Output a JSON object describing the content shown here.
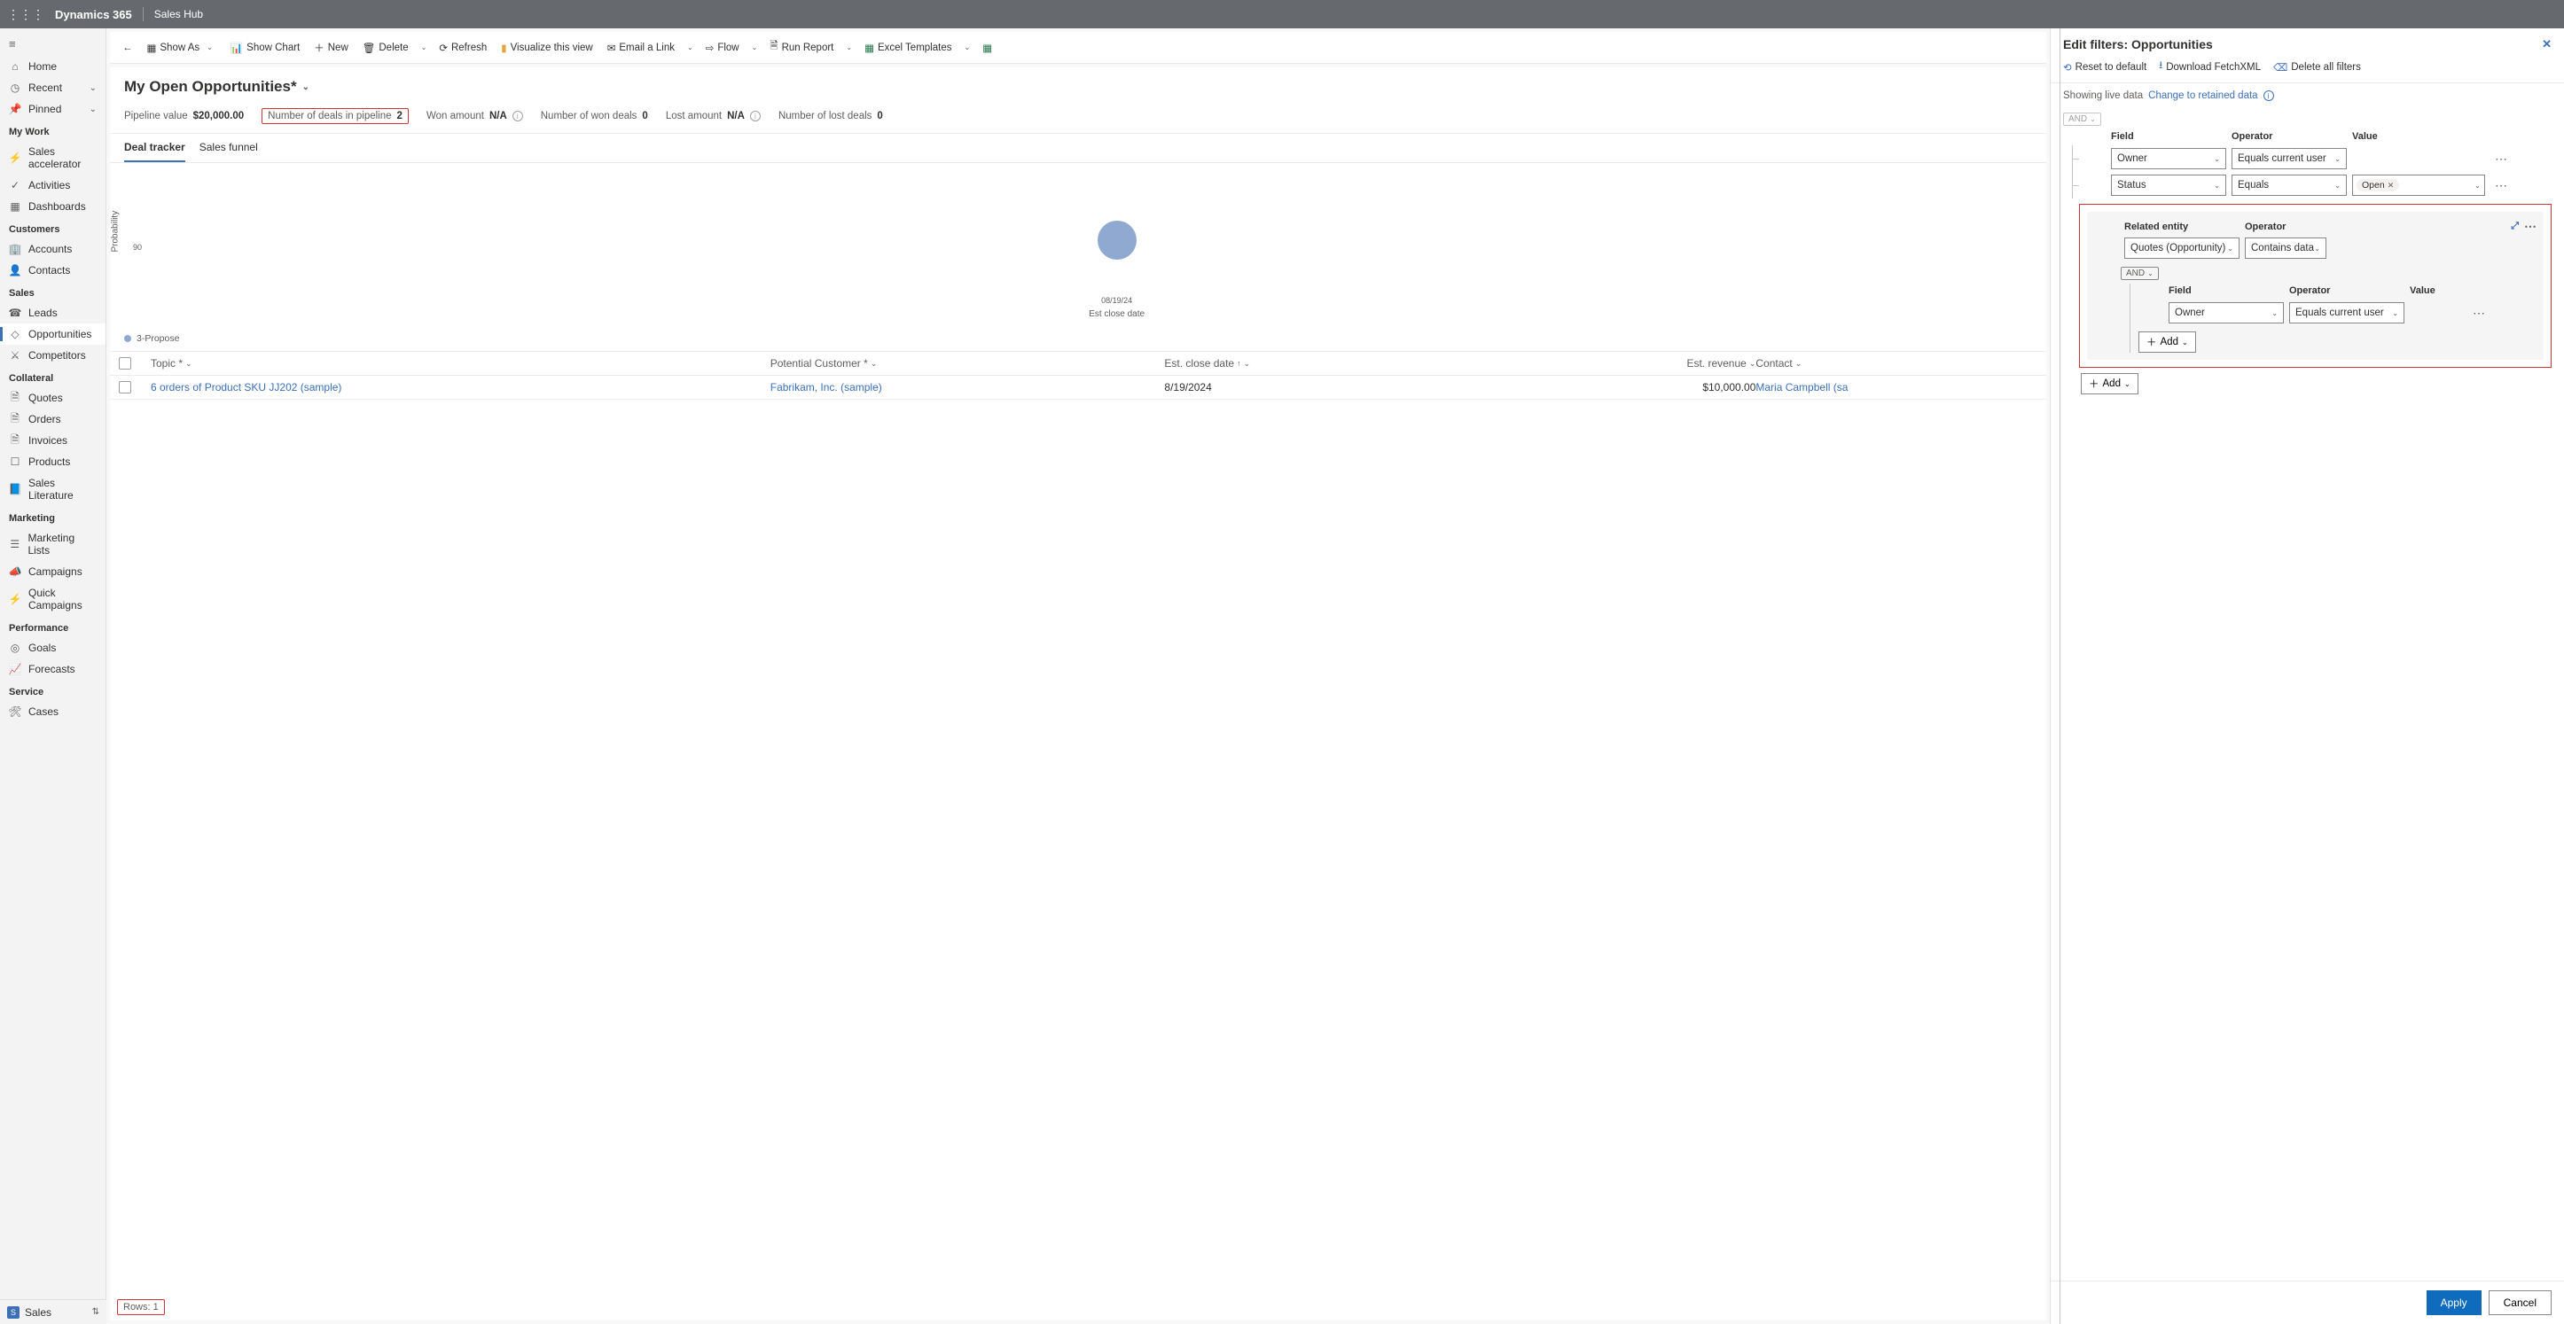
{
  "topbar": {
    "brand": "Dynamics 365",
    "app": "Sales Hub"
  },
  "sidebar": {
    "top": [
      {
        "icon": "home",
        "label": "Home"
      },
      {
        "icon": "clock",
        "label": "Recent",
        "caret": true
      },
      {
        "icon": "pin",
        "label": "Pinned",
        "caret": true
      }
    ],
    "sections": [
      {
        "title": "My Work",
        "items": [
          {
            "icon": "accel",
            "label": "Sales accelerator"
          },
          {
            "icon": "check",
            "label": "Activities"
          },
          {
            "icon": "dash",
            "label": "Dashboards"
          }
        ]
      },
      {
        "title": "Customers",
        "items": [
          {
            "icon": "bldg",
            "label": "Accounts"
          },
          {
            "icon": "user",
            "label": "Contacts"
          }
        ]
      },
      {
        "title": "Sales",
        "items": [
          {
            "icon": "phone",
            "label": "Leads"
          },
          {
            "icon": "opp",
            "label": "Opportunities",
            "selected": true
          },
          {
            "icon": "comp",
            "label": "Competitors"
          }
        ]
      },
      {
        "title": "Collateral",
        "items": [
          {
            "icon": "doc",
            "label": "Quotes"
          },
          {
            "icon": "doc",
            "label": "Orders"
          },
          {
            "icon": "doc",
            "label": "Invoices"
          },
          {
            "icon": "box",
            "label": "Products"
          },
          {
            "icon": "book",
            "label": "Sales Literature"
          }
        ]
      },
      {
        "title": "Marketing",
        "items": [
          {
            "icon": "list",
            "label": "Marketing Lists"
          },
          {
            "icon": "camp",
            "label": "Campaigns"
          },
          {
            "icon": "bolt",
            "label": "Quick Campaigns"
          }
        ]
      },
      {
        "title": "Performance",
        "items": [
          {
            "icon": "target",
            "label": "Goals"
          },
          {
            "icon": "chart",
            "label": "Forecasts"
          }
        ]
      },
      {
        "title": "Service",
        "items": [
          {
            "icon": "wrench",
            "label": "Cases"
          }
        ]
      }
    ],
    "footer": {
      "badge": "S",
      "label": "Sales"
    }
  },
  "commands": {
    "back": "←",
    "showAs": "Show As",
    "showChart": "Show Chart",
    "new": "New",
    "delete": "Delete",
    "refresh": "Refresh",
    "visualize": "Visualize this view",
    "emailLink": "Email a Link",
    "flow": "Flow",
    "runReport": "Run Report",
    "excelTemplates": "Excel Templates"
  },
  "view": {
    "title": "My Open Opportunities*",
    "metrics": [
      {
        "label": "Pipeline value",
        "value": "$20,000.00"
      },
      {
        "label": "Number of deals in pipeline",
        "value": "2",
        "highlight": true
      },
      {
        "label": "Won amount",
        "value": "N/A",
        "info": true
      },
      {
        "label": "Number of won deals",
        "value": "0"
      },
      {
        "label": "Lost amount",
        "value": "N/A",
        "info": true
      },
      {
        "label": "Number of lost deals",
        "value": "0"
      }
    ],
    "tabs": [
      {
        "label": "Deal tracker",
        "active": true
      },
      {
        "label": "Sales funnel"
      }
    ]
  },
  "chart_data": {
    "type": "scatter",
    "ylabel": "Probability",
    "xlabel": "Est close date",
    "ytick": "90",
    "xdate": "08/19/24",
    "legend": "3-Propose",
    "series": [
      {
        "name": "3-Propose",
        "points": [
          {
            "x": "08/19/24",
            "y": 90,
            "size": 44
          }
        ]
      }
    ]
  },
  "grid": {
    "columns": [
      {
        "label": "Topic *",
        "sort": "desc"
      },
      {
        "label": "Potential Customer *",
        "sort": "desc"
      },
      {
        "label": "Est. close date",
        "sort": "asc"
      },
      {
        "label": "Est. revenue",
        "sort": "desc",
        "align": "right"
      },
      {
        "label": "Contact",
        "sort": "desc"
      }
    ],
    "rows": [
      {
        "topic": "6 orders of Product SKU JJ202 (sample)",
        "customer": "Fabrikam, Inc. (sample)",
        "closeDate": "8/19/2024",
        "revenue": "$10,000.00",
        "contact": "Maria Campbell (sa"
      }
    ],
    "rowsLabel": "Rows: 1"
  },
  "filter": {
    "title": "Edit filters: Opportunities",
    "toolbar": {
      "reset": "Reset to default",
      "fetchxml": "Download FetchXML",
      "deleteAll": "Delete all filters"
    },
    "live": {
      "prefix": "Showing live data",
      "link": "Change to retained data"
    },
    "andLabel": "AND",
    "headers": {
      "field": "Field",
      "operator": "Operator",
      "value": "Value",
      "related": "Related entity"
    },
    "rows": [
      {
        "field": "Owner",
        "operator": "Equals current user"
      },
      {
        "field": "Status",
        "operator": "Equals",
        "chip": "Open"
      }
    ],
    "related": {
      "entity": "Quotes (Opportunity)",
      "operator": "Contains data",
      "nested": {
        "field": "Owner",
        "operator": "Equals current user"
      }
    },
    "addBtn": "Add",
    "apply": "Apply",
    "cancel": "Cancel"
  }
}
